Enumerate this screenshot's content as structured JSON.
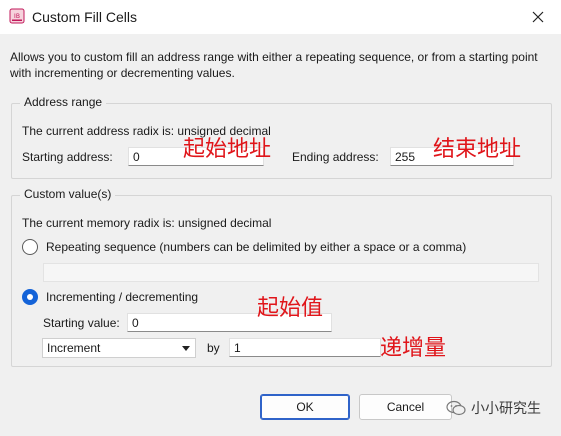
{
  "window": {
    "title": "Custom Fill Cells",
    "app_icon_text": "IB"
  },
  "description": "Allows you to custom fill an address range with either a repeating sequence, or from a starting point with incrementing or decrementing values.",
  "address_range": {
    "legend": "Address range",
    "radix_text": "The current address radix is: unsigned decimal",
    "starting_label": "Starting address:",
    "starting_value": "0",
    "ending_label": "Ending address:",
    "ending_value": "255"
  },
  "custom_values": {
    "legend": "Custom value(s)",
    "radix_text": "The current memory radix is: unsigned decimal",
    "repeating_label": "Repeating sequence (numbers can be delimited by either a space or a comma)",
    "repeating_value": "",
    "incrementing_label": "Incrementing / decrementing",
    "starting_value_label": "Starting value:",
    "starting_value": "0",
    "mode_selected": "Increment",
    "by_label": "by",
    "by_value": "1"
  },
  "annotations": {
    "start_address": "起始地址",
    "end_address": "结束地址",
    "start_value": "起始值",
    "increment": "递增量"
  },
  "buttons": {
    "ok": "OK",
    "cancel": "Cancel"
  },
  "watermark": "小小研究生",
  "colors": {
    "accent": "#1463d8",
    "annotation": "#e0151a",
    "ok_border": "#2f63c9"
  }
}
